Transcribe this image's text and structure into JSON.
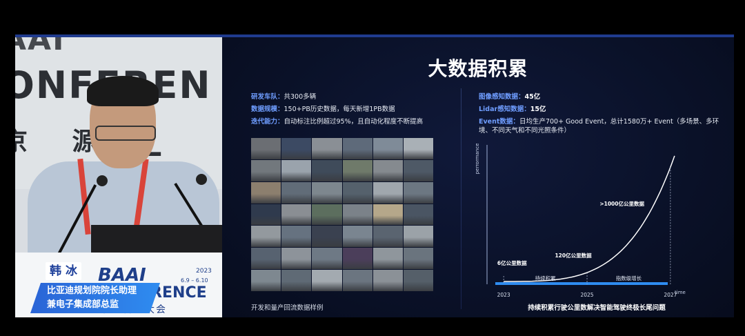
{
  "overlay": {
    "name": "韩 冰",
    "title_line1": "比亚迪规划院院长助理",
    "title_line2": "兼电子集成部总监",
    "brand": "BAAI",
    "brand2": "FERENCE",
    "year": "2023",
    "dates": "6.9 – 6.10",
    "brand_cn": "北京智源大会",
    "backdrop_line1": "AAI",
    "backdrop_line2": "ONFEREN",
    "backdrop_line3": "京 源 ▁"
  },
  "slide": {
    "title": "大数据积累",
    "left_info": [
      {
        "key": "研发车队：",
        "value": "共300多辆"
      },
      {
        "key": "数据规模：",
        "value": "150+PB历史数据，每天新增1PB数据"
      },
      {
        "key": "迭代能力：",
        "value": "自动标注比例超过95%，且自动化程度不断提高"
      }
    ],
    "right_info": [
      {
        "key": "图像感知数据：",
        "value": "45亿"
      },
      {
        "key": "Lidar感知数据：",
        "value": "15亿"
      },
      {
        "key": "Event数据：",
        "value": "日均生产700+ Good Event，总计1580万+ Event（多场景、多环"
      },
      {
        "key": "",
        "value": "境、不同天气和不同光照条件）"
      }
    ],
    "grid_caption": "开发和量产回流数据样例",
    "chart_caption": "持续积累行驶公里数解决智能驾驶终极长尾问题"
  },
  "chart_data": {
    "type": "line",
    "title": "",
    "xlabel": "time",
    "ylabel": "performance",
    "x_ticks": [
      "2023",
      "2025",
      "2027"
    ],
    "phases": [
      "持续积累",
      "指数级增长"
    ],
    "annotations": [
      {
        "x": 2023.2,
        "label": "6亿公里数据"
      },
      {
        "x": 2025.0,
        "label": "120亿公里数据"
      },
      {
        "x": 2026.5,
        "label": ">1000亿公里数据"
      }
    ],
    "curve": "exponential",
    "colors": {
      "curve": "#ffffff",
      "axis_bar": "#2f8cf0",
      "accent": "#6f9dff"
    }
  },
  "grid_colors": [
    "#6b6e73",
    "#3c4a63",
    "#8a8f95",
    "#5e6a7a",
    "#7f8b98",
    "#a9b0b6",
    "#72787d",
    "#9aa3ac",
    "#3f4b5a",
    "#6f7a6a",
    "#858a8f",
    "#4e5966",
    "#8c7f6e",
    "#616c78",
    "#7d878e",
    "#55616c",
    "#a0a7ad",
    "#6c7782",
    "#2f3a4d",
    "#8a8e93",
    "#5c6e5e",
    "#7b8289",
    "#b5a78a",
    "#4a5563",
    "#93999e",
    "#667280",
    "#3a4150",
    "#7a8590",
    "#5a6470",
    "#9ba2a8",
    "#576270",
    "#8d939a",
    "#6e7985",
    "#4b3e5a",
    "#8f969c",
    "#6a747e",
    "#7e8890",
    "#5f6a75",
    "#a3aab0",
    "#6b7580",
    "#8b9197",
    "#555f69"
  ]
}
